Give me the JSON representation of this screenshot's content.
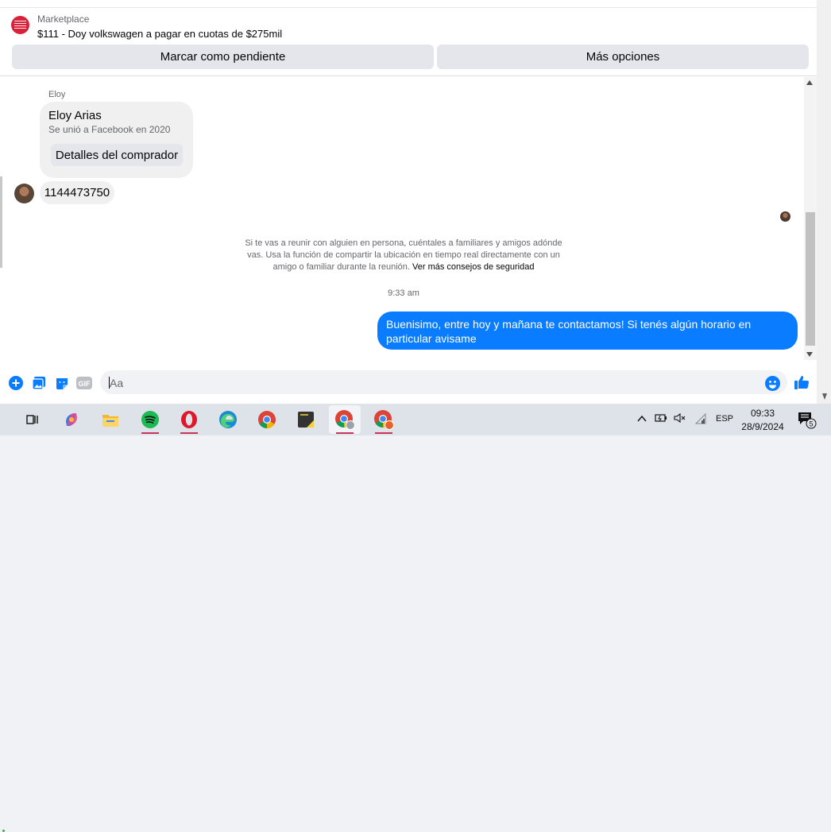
{
  "header": {
    "category": "Marketplace",
    "listing_title": "$111 - Doy volkswagen a pagar en cuotas de $275mil",
    "mark_pending_label": "Marcar como pendiente",
    "more_options_label": "Más opciones"
  },
  "chat": {
    "sender_name": "Eloy",
    "buyer_card": {
      "name": "Eloy Arias",
      "joined": "Se unió a Facebook en 2020",
      "details_button": "Detalles del comprador"
    },
    "incoming_message": "1144473750",
    "safety_notice": "Si te vas a reunir con alguien en persona, cuéntales a familiares y amigos adónde vas. Usa la función de compartir la ubicación en tiempo real directamente con un amigo o familiar durante la reunión.",
    "safety_link": "Ver más consejos de seguridad",
    "timestamp": "9:33 am",
    "outgoing_message": "Buenisimo, entre hoy y mañana te contactamos! Si tenés algún horario en particular avisame"
  },
  "composer": {
    "placeholder": "Aa",
    "gif_label": "GIF"
  },
  "taskbar": {
    "language": "ESP",
    "time": "09:33",
    "date": "28/9/2024",
    "notification_count": "5",
    "colors": {
      "accent_underline": "#c8355a",
      "messenger_blue": "#0a7cff"
    }
  }
}
